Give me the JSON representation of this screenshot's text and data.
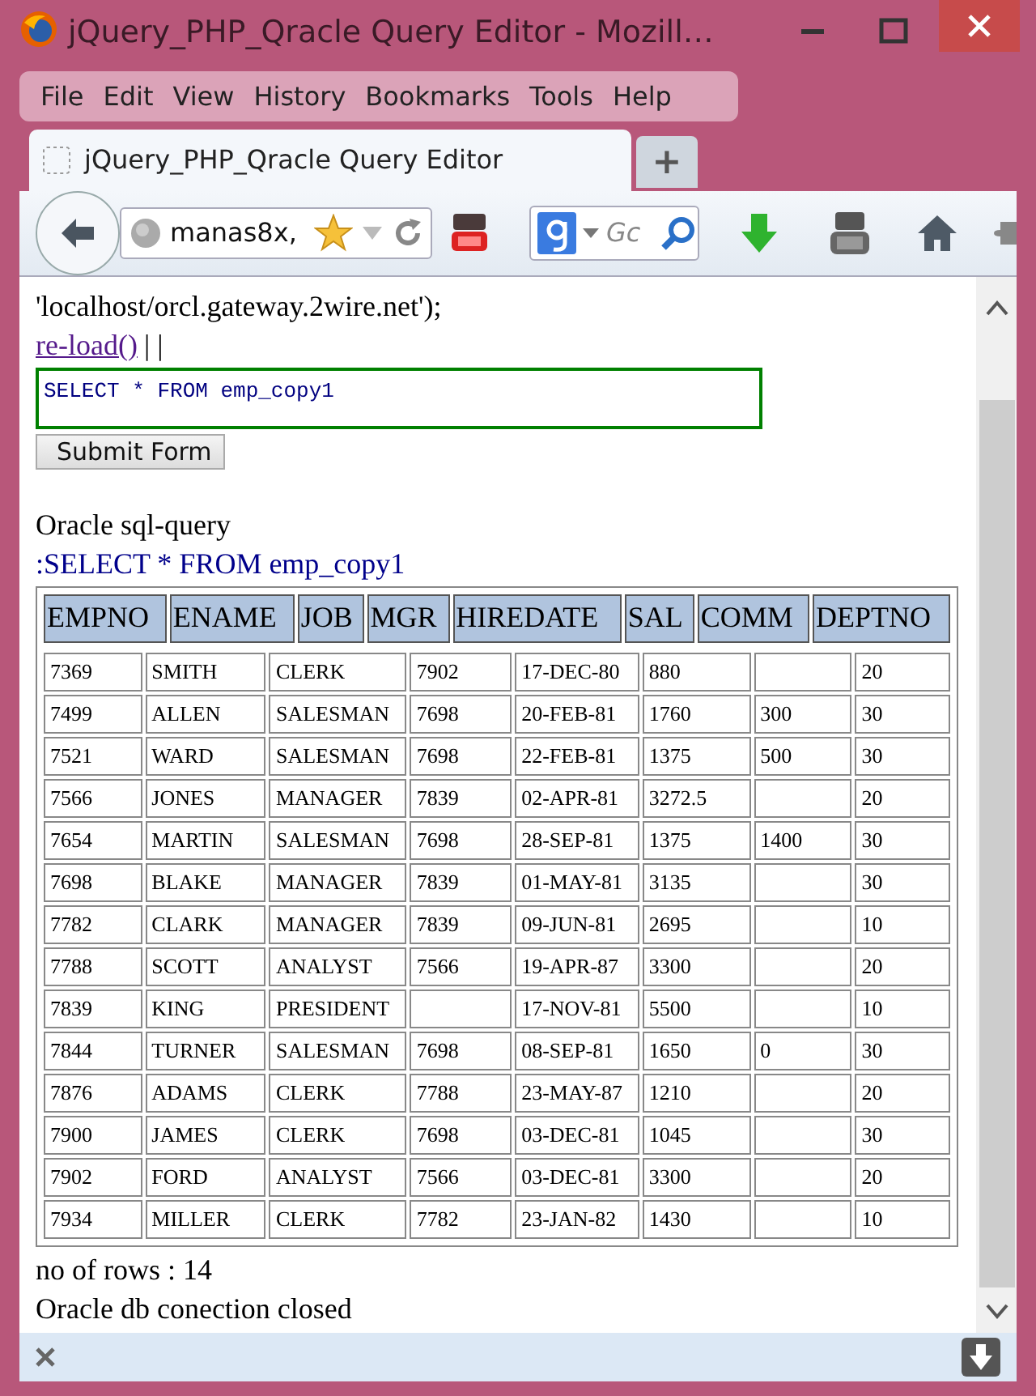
{
  "window": {
    "title": "jQuery_PHP_Qracle Query Editor - Mozill…"
  },
  "menu": [
    "File",
    "Edit",
    "View",
    "History",
    "Bookmarks",
    "Tools",
    "Help"
  ],
  "tabs": [
    {
      "label": "jQuery_PHP_Qracle Query Editor",
      "selected": true
    }
  ],
  "new_tab": "+",
  "address_bar": {
    "value": "manas8x,"
  },
  "search": {
    "placeholder": "Gc"
  },
  "page": {
    "connection_line": "'localhost/orcl.gateway.2wire.net');",
    "reload_link": "re-load()",
    "separator": "| |",
    "query_value": "SELECT * FROM emp_copy1",
    "submit": "Submit Form",
    "result_heading": "Oracle sql-query",
    "result_query": ":SELECT * FROM emp_copy1"
  },
  "table": {
    "columns": [
      "EMPNO",
      "ENAME",
      "JOB",
      "MGR",
      "HIREDATE",
      "SAL",
      "COMM",
      "DEPTNO"
    ],
    "rows": [
      [
        "7369",
        "SMITH",
        "CLERK",
        "7902",
        "17-DEC-80",
        "880",
        "",
        "20"
      ],
      [
        "7499",
        "ALLEN",
        "SALESMAN",
        "7698",
        "20-FEB-81",
        "1760",
        "300",
        "30"
      ],
      [
        "7521",
        "WARD",
        "SALESMAN",
        "7698",
        "22-FEB-81",
        "1375",
        "500",
        "30"
      ],
      [
        "7566",
        "JONES",
        "MANAGER",
        "7839",
        "02-APR-81",
        "3272.5",
        "",
        "20"
      ],
      [
        "7654",
        "MARTIN",
        "SALESMAN",
        "7698",
        "28-SEP-81",
        "1375",
        "1400",
        "30"
      ],
      [
        "7698",
        "BLAKE",
        "MANAGER",
        "7839",
        "01-MAY-81",
        "3135",
        "",
        "30"
      ],
      [
        "7782",
        "CLARK",
        "MANAGER",
        "7839",
        "09-JUN-81",
        "2695",
        "",
        "10"
      ],
      [
        "7788",
        "SCOTT",
        "ANALYST",
        "7566",
        "19-APR-87",
        "3300",
        "",
        "20"
      ],
      [
        "7839",
        "KING",
        "PRESIDENT",
        "",
        "17-NOV-81",
        "5500",
        "",
        "10"
      ],
      [
        "7844",
        "TURNER",
        "SALESMAN",
        "7698",
        "08-SEP-81",
        "1650",
        "0",
        "30"
      ],
      [
        "7876",
        "ADAMS",
        "CLERK",
        "7788",
        "23-MAY-87",
        "1210",
        "",
        "20"
      ],
      [
        "7900",
        "JAMES",
        "CLERK",
        "7698",
        "03-DEC-81",
        "1045",
        "",
        "30"
      ],
      [
        "7902",
        "FORD",
        "ANALYST",
        "7566",
        "03-DEC-81",
        "3300",
        "",
        "20"
      ],
      [
        "7934",
        "MILLER",
        "CLERK",
        "7782",
        "23-JAN-82",
        "1430",
        "",
        "10"
      ]
    ]
  },
  "footer": {
    "row_count": "no of rows : 14",
    "status": "Oracle db conection closed"
  }
}
